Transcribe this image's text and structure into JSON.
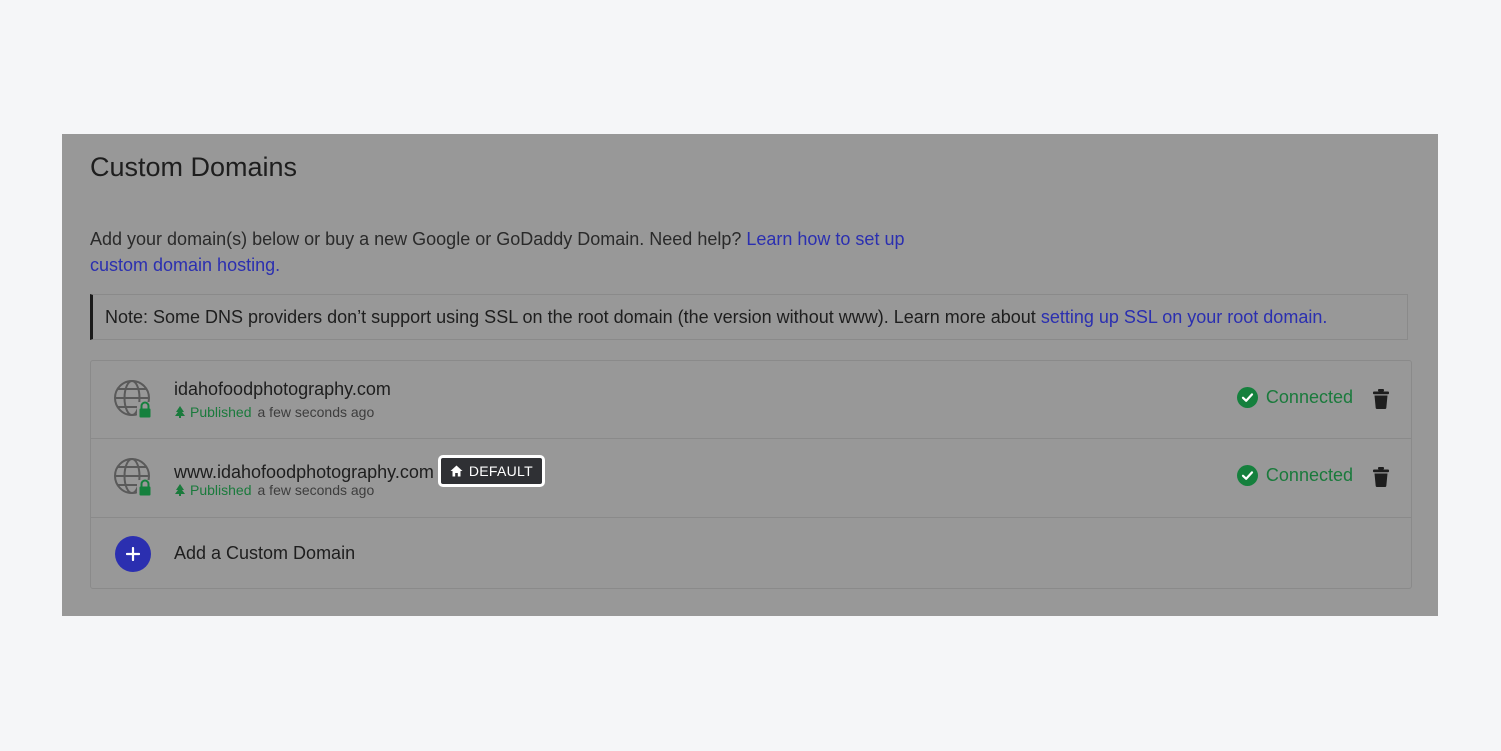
{
  "section": {
    "title": "Custom Domains",
    "intro_text": "Add your domain(s) below or buy a new Google or GoDaddy Domain. Need help? ",
    "intro_link": "Learn how to set up custom domain hosting.",
    "note_text": "Note: Some DNS providers don’t support using SSL on the root domain (the version without www). Learn more about ",
    "note_link": "setting up SSL on your root domain."
  },
  "domains": [
    {
      "name": "idahofoodphotography.com",
      "publish_status": "Published",
      "publish_time": "a few seconds ago",
      "connection_status": "Connected"
    },
    {
      "name": "www.idahofoodphotography.com",
      "badge": "DEFAULT",
      "publish_status": "Published",
      "publish_time": "a few seconds ago",
      "connection_status": "Connected"
    }
  ],
  "add_domain": {
    "label": "Add a Custom Domain"
  },
  "icons": {
    "globe": "globe-lock-icon",
    "publish": "tree-icon",
    "connected": "check-circle-icon",
    "delete": "trash-icon",
    "home": "home-icon",
    "add": "plus-icon"
  },
  "colors": {
    "link": "#2b2fb0",
    "success": "#15803d",
    "badge_bg": "#2f3034",
    "overlay": "#989898"
  }
}
